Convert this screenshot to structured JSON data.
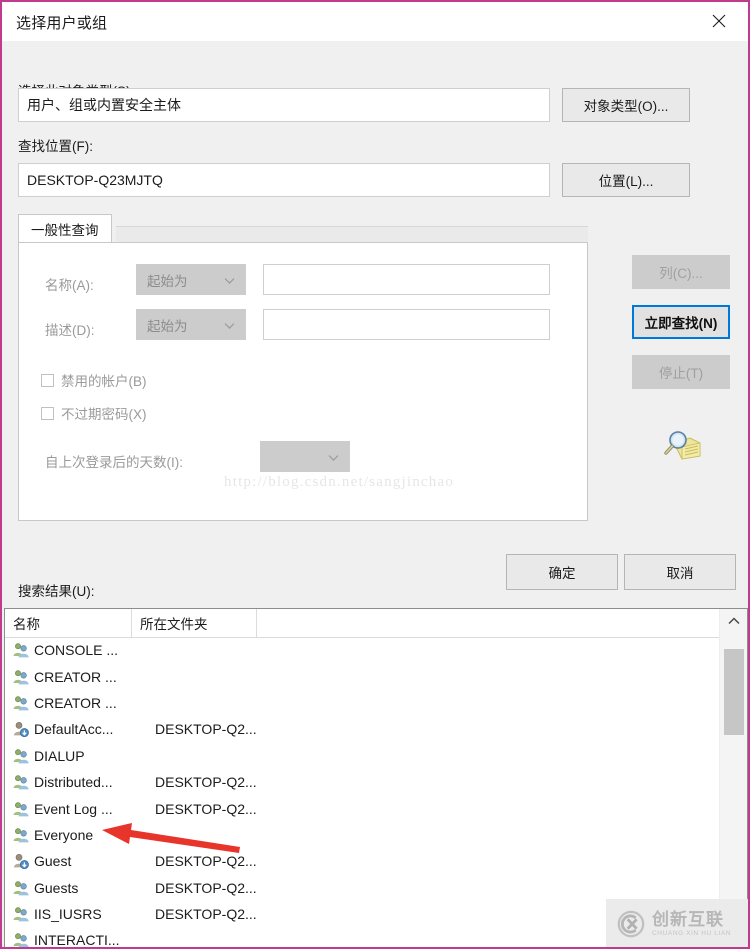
{
  "window": {
    "title": "选择用户或组",
    "close_icon": "close-icon",
    "border_color": "#bf3b8e",
    "surface_color": "#f0f0f0"
  },
  "object_type": {
    "label": "选择此对象类型(S):",
    "value": "用户、组或内置安全主体",
    "button_label": "对象类型(O)..."
  },
  "location": {
    "label": "查找位置(F):",
    "value": "DESKTOP-Q23MJTQ",
    "button_label": "位置(L)..."
  },
  "query": {
    "tab_label": "一般性查询",
    "name": {
      "label": "名称(A):",
      "operator": "起始为",
      "value": "",
      "placeholder": ""
    },
    "description": {
      "label": "描述(D):",
      "operator": "起始为",
      "value": "",
      "placeholder": ""
    },
    "checkboxes": [
      {
        "label": "禁用的帐户(B)",
        "checked": false
      },
      {
        "label": "不过期密码(X)",
        "checked": false
      }
    ],
    "days_since_logon": {
      "label": "自上次登录后的天数(I):",
      "value": ""
    },
    "watermark_url": "http://blog.csdn.net/sangjinchao",
    "search_icon": "magnifier-folder-icon"
  },
  "side_buttons": {
    "columns": {
      "label": "列(C)...",
      "enabled": false
    },
    "find_now": {
      "label": "立即查找(N)",
      "enabled": true,
      "focused": true,
      "focus_color": "#0078d7"
    },
    "stop": {
      "label": "停止(T)",
      "enabled": false
    }
  },
  "footer": {
    "ok_label": "确定",
    "cancel_label": "取消"
  },
  "results": {
    "label": "搜索结果(U):",
    "columns": [
      "名称",
      "所在文件夹"
    ],
    "rows": [
      {
        "name": "CONSOLE ...",
        "folder": ""
      },
      {
        "name": "CREATOR ...",
        "folder": ""
      },
      {
        "name": "CREATOR ...",
        "folder": ""
      },
      {
        "name": "DefaultAcc...",
        "folder": "DESKTOP-Q2..."
      },
      {
        "name": "DIALUP",
        "folder": ""
      },
      {
        "name": "Distributed...",
        "folder": "DESKTOP-Q2..."
      },
      {
        "name": "Event Log ...",
        "folder": "DESKTOP-Q2..."
      },
      {
        "name": "Everyone",
        "folder": ""
      },
      {
        "name": "Guest",
        "folder": "DESKTOP-Q2..."
      },
      {
        "name": "Guests",
        "folder": "DESKTOP-Q2..."
      },
      {
        "name": "IIS_IUSRS",
        "folder": "DESKTOP-Q2..."
      },
      {
        "name": "INTERACTI...",
        "folder": ""
      }
    ],
    "scrollbar": {
      "up_icon": "chevron-up-icon"
    }
  },
  "annotation": {
    "arrow_color": "#e8352b",
    "points_to_row": "Everyone"
  },
  "badge": {
    "cn": "创新互联",
    "en": "CHUANG XIN HU LIAN"
  }
}
